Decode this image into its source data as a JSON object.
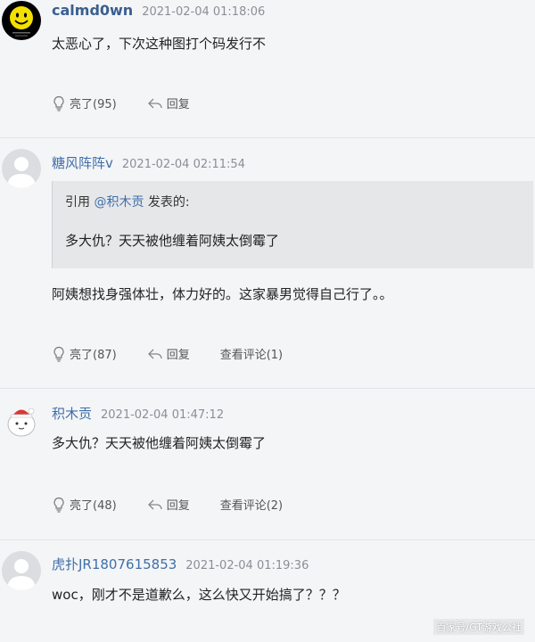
{
  "comments": [
    {
      "username": "calmd0wn",
      "time": "2021-02-04 01:18:06",
      "text": "太恶心了，下次这种图打个码发行不",
      "like_label": "亮了(95)",
      "reply_label": "回复",
      "avatar": "smiley-face"
    },
    {
      "username": "糖风阵阵v",
      "time": "2021-02-04 02:11:54",
      "quote_prefix": "引用 ",
      "quote_user": "@积木贡",
      "quote_suffix": " 发表的:",
      "quote_text": "多大仇？天天被他缠着阿姨太倒霉了",
      "text": "阿姨想找身强体壮，体力好的。这家暴男觉得自己行了。。",
      "like_label": "亮了(87)",
      "reply_label": "回复",
      "view_label": "查看评论(1)",
      "avatar": "default-user"
    },
    {
      "username": "积木贡",
      "time": "2021-02-04 01:47:12",
      "text": "多大仇？天天被他缠着阿姨太倒霉了",
      "like_label": "亮了(48)",
      "reply_label": "回复",
      "view_label": "查看评论(2)",
      "avatar": "cartoon-character"
    },
    {
      "username": "虎扑JR1807615853",
      "time": "2021-02-04 01:19:36",
      "text": "woc，刚才不是道歉么，这么快又开始搞了？？？",
      "avatar": "default-user"
    }
  ],
  "watermark": "百家号/GT游戏公社",
  "colors": {
    "background": "#f4f5f7",
    "username": "#3f6fa8",
    "timestamp": "#8a8f96",
    "quote_bg": "#e6e7e9",
    "divider": "#e3e5e8"
  }
}
